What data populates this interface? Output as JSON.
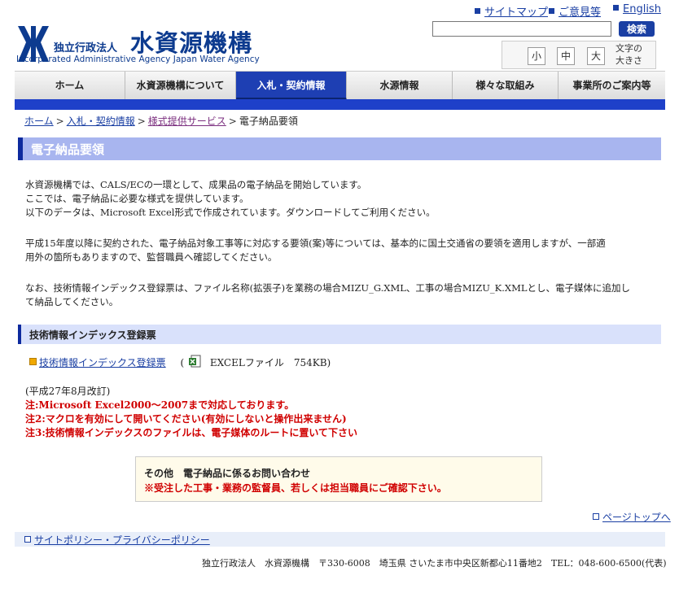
{
  "header": {
    "logo_small": "独立行政法人",
    "logo_big": "水資源機構",
    "logo_en": "Incorporated Administrative Agency Japan Water Agency",
    "links": [
      {
        "label": "サイトマップ"
      },
      {
        "label": "ご意見等"
      },
      {
        "label": "English"
      }
    ],
    "search_value": "",
    "search_button": "検索",
    "font_sizes": [
      "小",
      "中",
      "大"
    ],
    "font_size_label": "文字の\n大きさ"
  },
  "nav": {
    "items": [
      {
        "label": "ホーム"
      },
      {
        "label": "水資源機構について"
      },
      {
        "label": "入札・契約情報"
      },
      {
        "label": "水源情報"
      },
      {
        "label": "様々な取組み"
      },
      {
        "label": "事業所のご案内等"
      }
    ],
    "active": "入札・契約情報"
  },
  "breadcrumb": [
    {
      "label": "ホーム"
    },
    {
      "label": "入札・契約情報"
    },
    {
      "label": "様式提供サービス"
    },
    {
      "label": "電子納品要領"
    }
  ],
  "breadcrumb_sep": ">",
  "page_title": "電子納品要領",
  "paragraphs": [
    "水資源機構では、CALS/ECの一環として、成果品の電子納品を開始しています。",
    "ここでは、電子納品に必要な様式を提供しています。",
    "以下のデータは、Microsoft Excel形式で作成されています。ダウンロードしてご利用ください。",
    "平成15年度以降に契約された、電子納品対象工事等に対応する要領(案)等については、基本的に国土交通省の要領を適用しますが、一部適",
    "用外の箇所もありますので、監督職員へ確認してください。",
    "なお、技術情報インデックス登録票は、ファイル名称(拡張子)を業務の場合MIZU_G.XML、工事の場合MIZU_K.XMLとし、電子媒体に追加し",
    "て納品してください。"
  ],
  "section": {
    "heading": "技術情報インデックス登録票",
    "download_link": "技術情報インデックス登録票",
    "file_info": "EXCELファイル　754KB)",
    "file_open_paren": "("
  },
  "notes": {
    "revised": "(平成27年8月改訂)",
    "note1": "注:Microsoft Excel2000〜2007まで対応しております。",
    "note2": "注2:マクロを有効にして開いてください(有効にしないと操作出来ません)",
    "note3": "注3:技術情報インデックスのファイルは、電子媒体のルートに置いて下さい"
  },
  "contact": {
    "title": "その他　電子納品に係るお問い合わせ",
    "note": "※受注した工事・業務の監督員、若しくは担当職員にご確認下さい。"
  },
  "pagetop": "ページトップへ",
  "policy_link": "サイトポリシー・プライバシーポリシー",
  "footer": "独立行政法人　水資源機構　〒330-6008　埼玉県 さいたま市中央区新都心11番地2　TEL：048-600-6500(代表)",
  "colors": {
    "brand": "#0d3b8f",
    "nav_active": "#1e3fb3",
    "nav_bar": "#1e40c9",
    "title_bg": "#a8b5ef",
    "notice_red": "#d00000"
  }
}
